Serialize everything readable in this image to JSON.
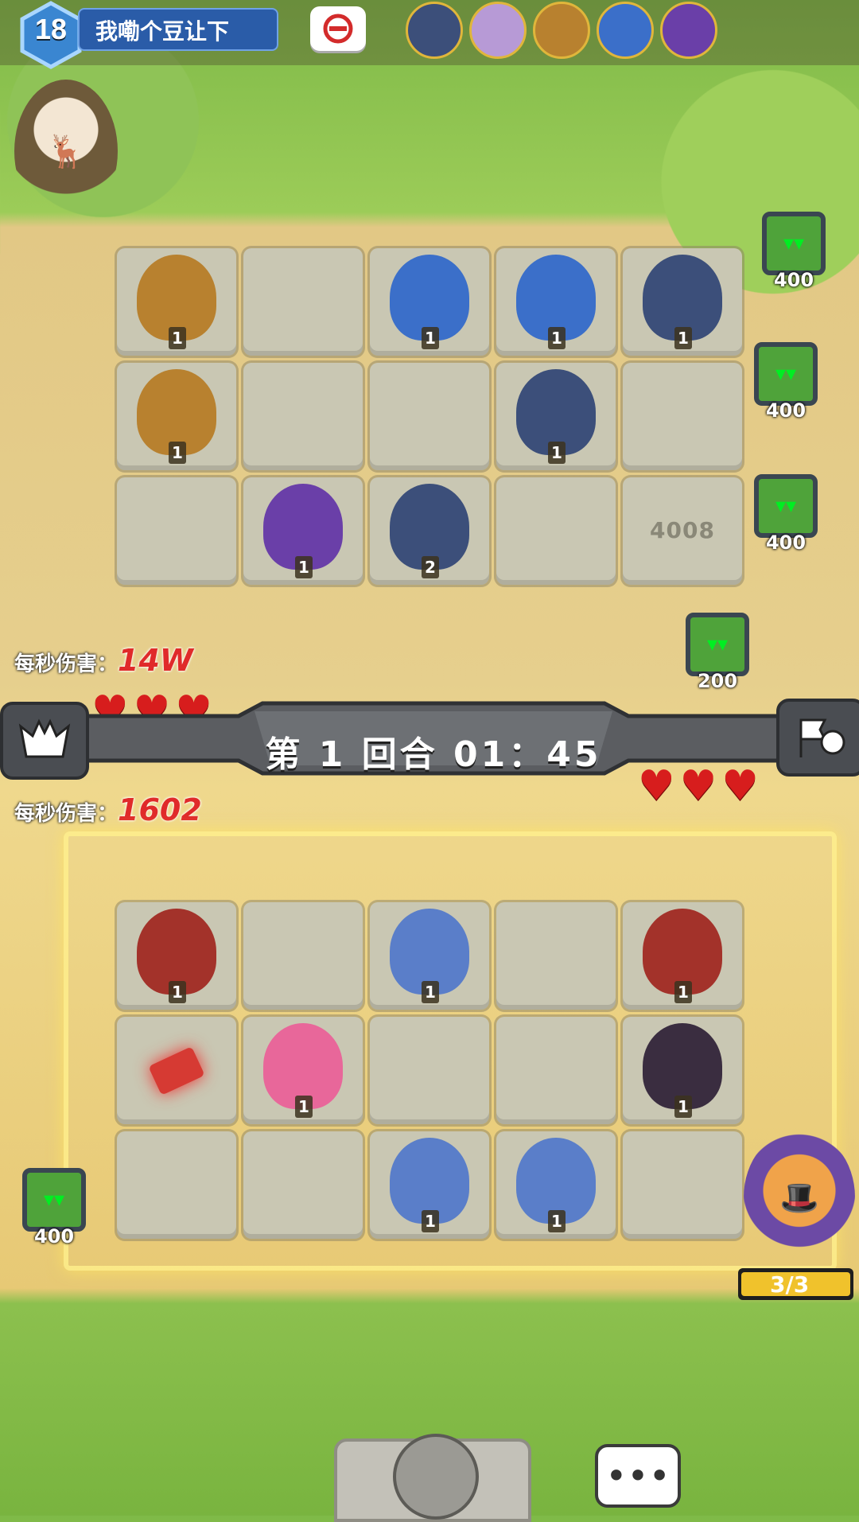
{
  "player": {
    "level": "18",
    "name": "我嘞个豆让下"
  },
  "enemy_heroes": [
    "frost-knight-icon",
    "maid-icon",
    "hat-mage-icon",
    "pharaoh-icon",
    "purple-wizard-icon"
  ],
  "opponent": {
    "dps_label": "每秒伤害：",
    "dps_value": "14W",
    "hearts": 3,
    "board": [
      [
        {
          "unit": "hat-archer",
          "lv": "1"
        },
        {
          "unit": null
        },
        {
          "unit": "pharaoh",
          "lv": "1"
        },
        {
          "unit": "pharaoh",
          "lv": "1"
        },
        {
          "unit": "frost-knight",
          "lv": "1"
        }
      ],
      [
        {
          "unit": "hat-archer",
          "lv": "1"
        },
        {
          "unit": null
        },
        {
          "unit": null
        },
        {
          "unit": "frost-knight",
          "lv": "1"
        },
        {
          "unit": null
        }
      ],
      [
        {
          "unit": null
        },
        {
          "unit": "purple-wizard",
          "lv": "1"
        },
        {
          "unit": "frost-knight",
          "lv": "2"
        },
        {
          "unit": null
        },
        {
          "text": "4008"
        }
      ]
    ],
    "slimes": [
      "400",
      "400",
      "400",
      "200"
    ]
  },
  "round": {
    "label": "第 1 回合 01：45"
  },
  "self": {
    "dps_label": "每秒伤害：",
    "dps_value": "1602",
    "hearts": 3,
    "board": [
      [
        {
          "unit": "samurai",
          "lv": "1"
        },
        {
          "unit": null
        },
        {
          "unit": "mermaid",
          "lv": "1"
        },
        {
          "unit": null
        },
        {
          "unit": "samurai",
          "lv": "1"
        }
      ],
      [
        {
          "unit": "scroll-item"
        },
        {
          "unit": "pink-slime",
          "lv": "1"
        },
        {
          "unit": null
        },
        {
          "unit": null
        },
        {
          "unit": "maid",
          "lv": "1"
        }
      ],
      [
        {
          "unit": null
        },
        {
          "unit": null
        },
        {
          "unit": "mermaid",
          "lv": "1"
        },
        {
          "unit": "mermaid",
          "lv": "1"
        },
        {
          "unit": null
        }
      ]
    ],
    "slime": "400",
    "energy": "3/3",
    "energy_fraction": 1.0
  },
  "colors": {
    "hat-archer": "#b8812f",
    "pharaoh": "#3b6fc9",
    "frost-knight": "#3c4f7a",
    "purple-wizard": "#6a3fa8",
    "samurai": "#a3322a",
    "mermaid": "#5a7ec9",
    "pink-slime": "#e8679a",
    "maid": "#3a2d40",
    "scroll-item": "#d63a33"
  }
}
